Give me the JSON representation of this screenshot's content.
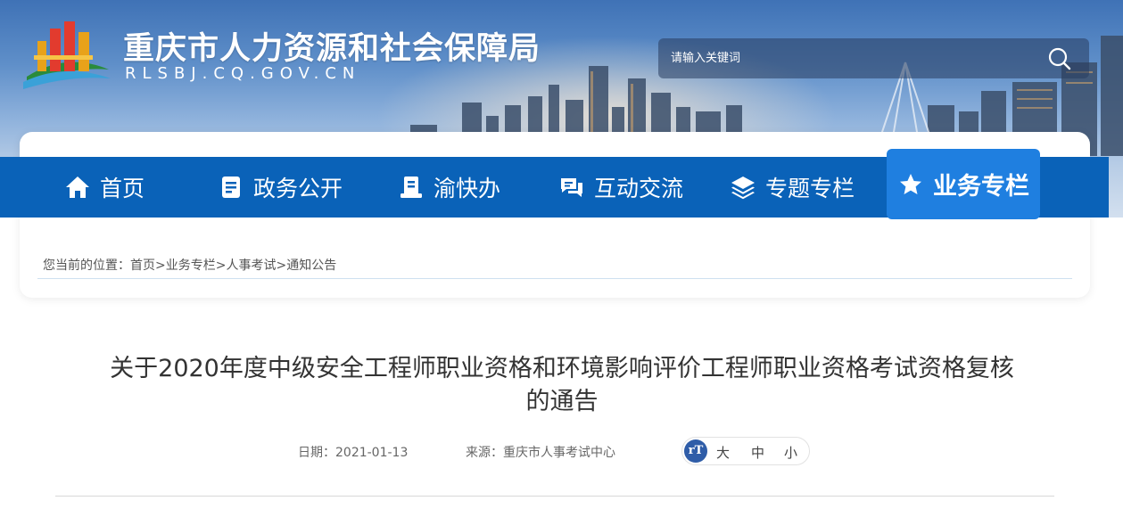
{
  "header": {
    "title": "重庆市人力资源和社会保障局",
    "domain": "RLSBJ.CQ.GOV.CN"
  },
  "search": {
    "placeholder": "请输入关键词"
  },
  "nav": {
    "items": [
      {
        "label": "首页",
        "icon": "home-icon"
      },
      {
        "label": "政务公开",
        "icon": "document-icon"
      },
      {
        "label": "渝快办",
        "icon": "book-icon"
      },
      {
        "label": "互动交流",
        "icon": "chat-icon"
      },
      {
        "label": "专题专栏",
        "icon": "layers-icon"
      },
      {
        "label": "业务专栏",
        "icon": "star-icon",
        "active": true
      }
    ]
  },
  "breadcrumb": {
    "prefix": "您当前的位置：",
    "items": [
      "首页",
      "业务专栏",
      "人事考试",
      "通知公告"
    ],
    "separator": ">"
  },
  "article": {
    "title_line1": "关于2020年度中级安全工程师职业资格和环境影响评价工程师职业资格考试资格复核",
    "title_line2": "的通告",
    "date_label": "日期：",
    "date": "2021-01-13",
    "source_label": "来源：",
    "source": "重庆市人事考试中心"
  },
  "font_size": {
    "large": "大",
    "medium": "中",
    "small": "小"
  },
  "colors": {
    "nav_bg": "#0a62b8",
    "nav_active": "#1f7fe0",
    "font_icon": "#2f5da8"
  }
}
